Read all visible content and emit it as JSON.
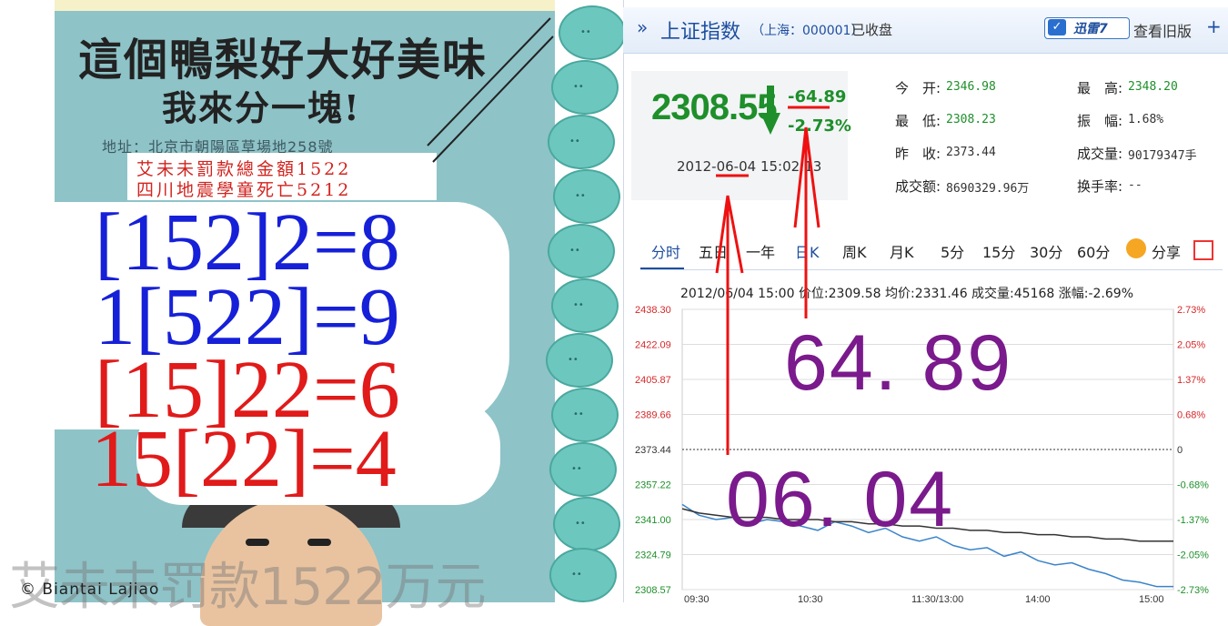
{
  "left": {
    "handwriting_line1": "這個鴨梨好大好美味",
    "handwriting_line2": "我來分一塊!",
    "address": "地址：北京市朝陽區草場地258號",
    "red_line1": "艾未未罰款總金額1522",
    "red_line2": "四川地震學童死亡5212",
    "equations": [
      "[152]2=8",
      "1[522]=9",
      "[15]22=6",
      "15[22]=4"
    ],
    "credit": "© Biantai Lajiao",
    "bottom_text": "艾未未罚款1522万元"
  },
  "stock": {
    "arrow": "»",
    "name": "上证指数",
    "code": "（上海：000001）",
    "status": "已收盘",
    "xunlei_label": "迅雷7",
    "old_version": "查看旧版",
    "plus": "+",
    "price": "2308.55",
    "change": "-64.89",
    "change_pct": "-2.73%",
    "datetime": "2012-06-04 15:02:13",
    "stats": {
      "open_label": "今　开:",
      "open": "2346.98",
      "low_label": "最　低:",
      "low": "2308.23",
      "prev_label": "昨　收:",
      "prev": "2373.44",
      "amount_label": "成交额:",
      "amount": "8690329.96万",
      "high_label": "最　高:",
      "high": "2348.20",
      "amp_label": "振　幅:",
      "amp": "1.68%",
      "vol_label": "成交量:",
      "vol": "90179347手",
      "turnover_label": "换手率:",
      "turnover": "--"
    },
    "tabs": [
      "分时",
      "五日",
      "一年",
      "日K",
      "周K",
      "月K",
      "5分",
      "15分",
      "30分",
      "60分"
    ],
    "share_label": "分享",
    "chart_info": "2012/06/04 15:00 价位:2309.58 均价:2331.46 成交量:45168 涨幅:-2.69%",
    "overlay_change": "64. 89",
    "overlay_date": "06. 04"
  },
  "chart_data": {
    "type": "line",
    "y_left_ticks": [
      "2438.30",
      "2422.09",
      "2405.87",
      "2389.66",
      "2373.44",
      "2357.22",
      "2341.00",
      "2324.79",
      "2308.57"
    ],
    "y_right_ticks": [
      "2.73%",
      "2.05%",
      "1.37%",
      "0.68%",
      "0",
      "-0.68%",
      "-1.37%",
      "-2.05%",
      "-2.73%"
    ],
    "x_ticks": [
      "09:30",
      "10:30",
      "11:30/13:00",
      "14:00",
      "15:00"
    ],
    "ylim": [
      2308.57,
      2438.3
    ],
    "baseline": 2373.44,
    "series": [
      {
        "values": [
          2348,
          2343,
          2341,
          2342,
          2339,
          2341,
          2340,
          2338,
          2336,
          2340,
          2338,
          2335,
          2337,
          2333,
          2331,
          2333,
          2329,
          2327,
          2328,
          2324,
          2326,
          2322,
          2320,
          2321,
          2318,
          2316,
          2313,
          2312,
          2310,
          2310
        ]
      },
      {
        "values": [
          2346,
          2344,
          2343,
          2342,
          2342,
          2342,
          2341,
          2341,
          2341,
          2340,
          2340,
          2339,
          2339,
          2338,
          2338,
          2337,
          2337,
          2336,
          2336,
          2335,
          2335,
          2334,
          2334,
          2333,
          2333,
          2332,
          2332,
          2331,
          2331,
          2331
        ]
      }
    ],
    "colors": {
      "price": "#3a84c9",
      "average": "#333333",
      "up": "#d62728",
      "down": "#1e8f2a"
    }
  }
}
